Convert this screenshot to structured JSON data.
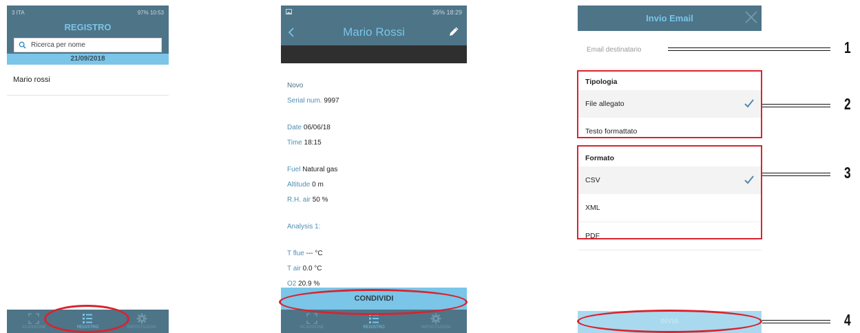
{
  "screen1": {
    "status_left": "3 ITA",
    "status_right": "97% 10:53",
    "title": "REGISTRO",
    "search_placeholder": "Ricerca per nome",
    "date": "21/09/2018",
    "entries": [
      "Mario rossi"
    ],
    "tabs": [
      "SCANSIONE",
      "REGISTRO",
      "IMPOSTAZIONI"
    ]
  },
  "screen2": {
    "status_right": "35% 18:29",
    "title": "Mario Rossi",
    "novo": "Novo",
    "fields": [
      {
        "label": "Serial num.",
        "value": "9997"
      },
      {
        "label": "Date",
        "value": "06/06/18"
      },
      {
        "label": "Time",
        "value": "18:15"
      },
      {
        "label": "Fuel",
        "value": "Natural gas"
      },
      {
        "label": "Altitude",
        "value": "0 m"
      },
      {
        "label": "R.H. air",
        "value": "50 %"
      },
      {
        "label": "Analysis 1:",
        "value": ""
      },
      {
        "label": "T flue",
        "value": "--- °C"
      },
      {
        "label": "T air",
        "value": "0.0 °C"
      },
      {
        "label": "O2",
        "value": "20.9 %"
      }
    ],
    "share_label": "CONDIVIDI",
    "tabs": [
      "SCANSIONE",
      "REGISTRO",
      "IMPOSTAZIONI"
    ]
  },
  "screen3": {
    "title": "Invio Email",
    "email_placeholder": "Email destinatario",
    "tipologia_label": "Tipologia",
    "tipologia_options": [
      "File allegato",
      "Testo formattato"
    ],
    "formato_label": "Formato",
    "formato_options": [
      "CSV",
      "XML",
      "PDF"
    ],
    "send_label": "INVIA"
  },
  "callouts": [
    "1",
    "2",
    "3",
    "4"
  ],
  "colors": {
    "header": "#4e7488",
    "accent": "#7ac5e8",
    "highlight": "#d9232e"
  }
}
